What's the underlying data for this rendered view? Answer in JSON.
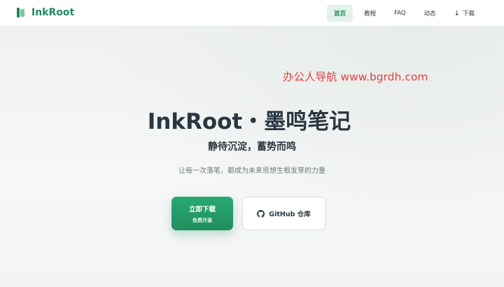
{
  "brand": {
    "name": "InkRoot",
    "color": "#1f8a5d",
    "icon": "book-icon"
  },
  "nav": {
    "items": [
      {
        "label": "首页",
        "active": true
      },
      {
        "label": "教程",
        "active": false
      },
      {
        "label": "FAQ",
        "active": false
      },
      {
        "label": "动态",
        "active": false
      },
      {
        "label": "下载",
        "active": false,
        "icon": "download-arrow-icon"
      }
    ]
  },
  "watermark": {
    "text": "办公人导航 www.bgrdh.com",
    "color": "#e34040"
  },
  "hero": {
    "title": "InkRoot・墨鸣笔记",
    "subtitle": "静待沉淀，蓄势而鸣",
    "description": "让每一次落笔，都成为未来思想生根发芽的力量"
  },
  "actions": {
    "primary": {
      "label": "立即下载",
      "sublabel": "免费开源",
      "color": "#1f8f5f"
    },
    "secondary": {
      "label": "GitHub 仓库",
      "icon": "github-icon"
    }
  }
}
